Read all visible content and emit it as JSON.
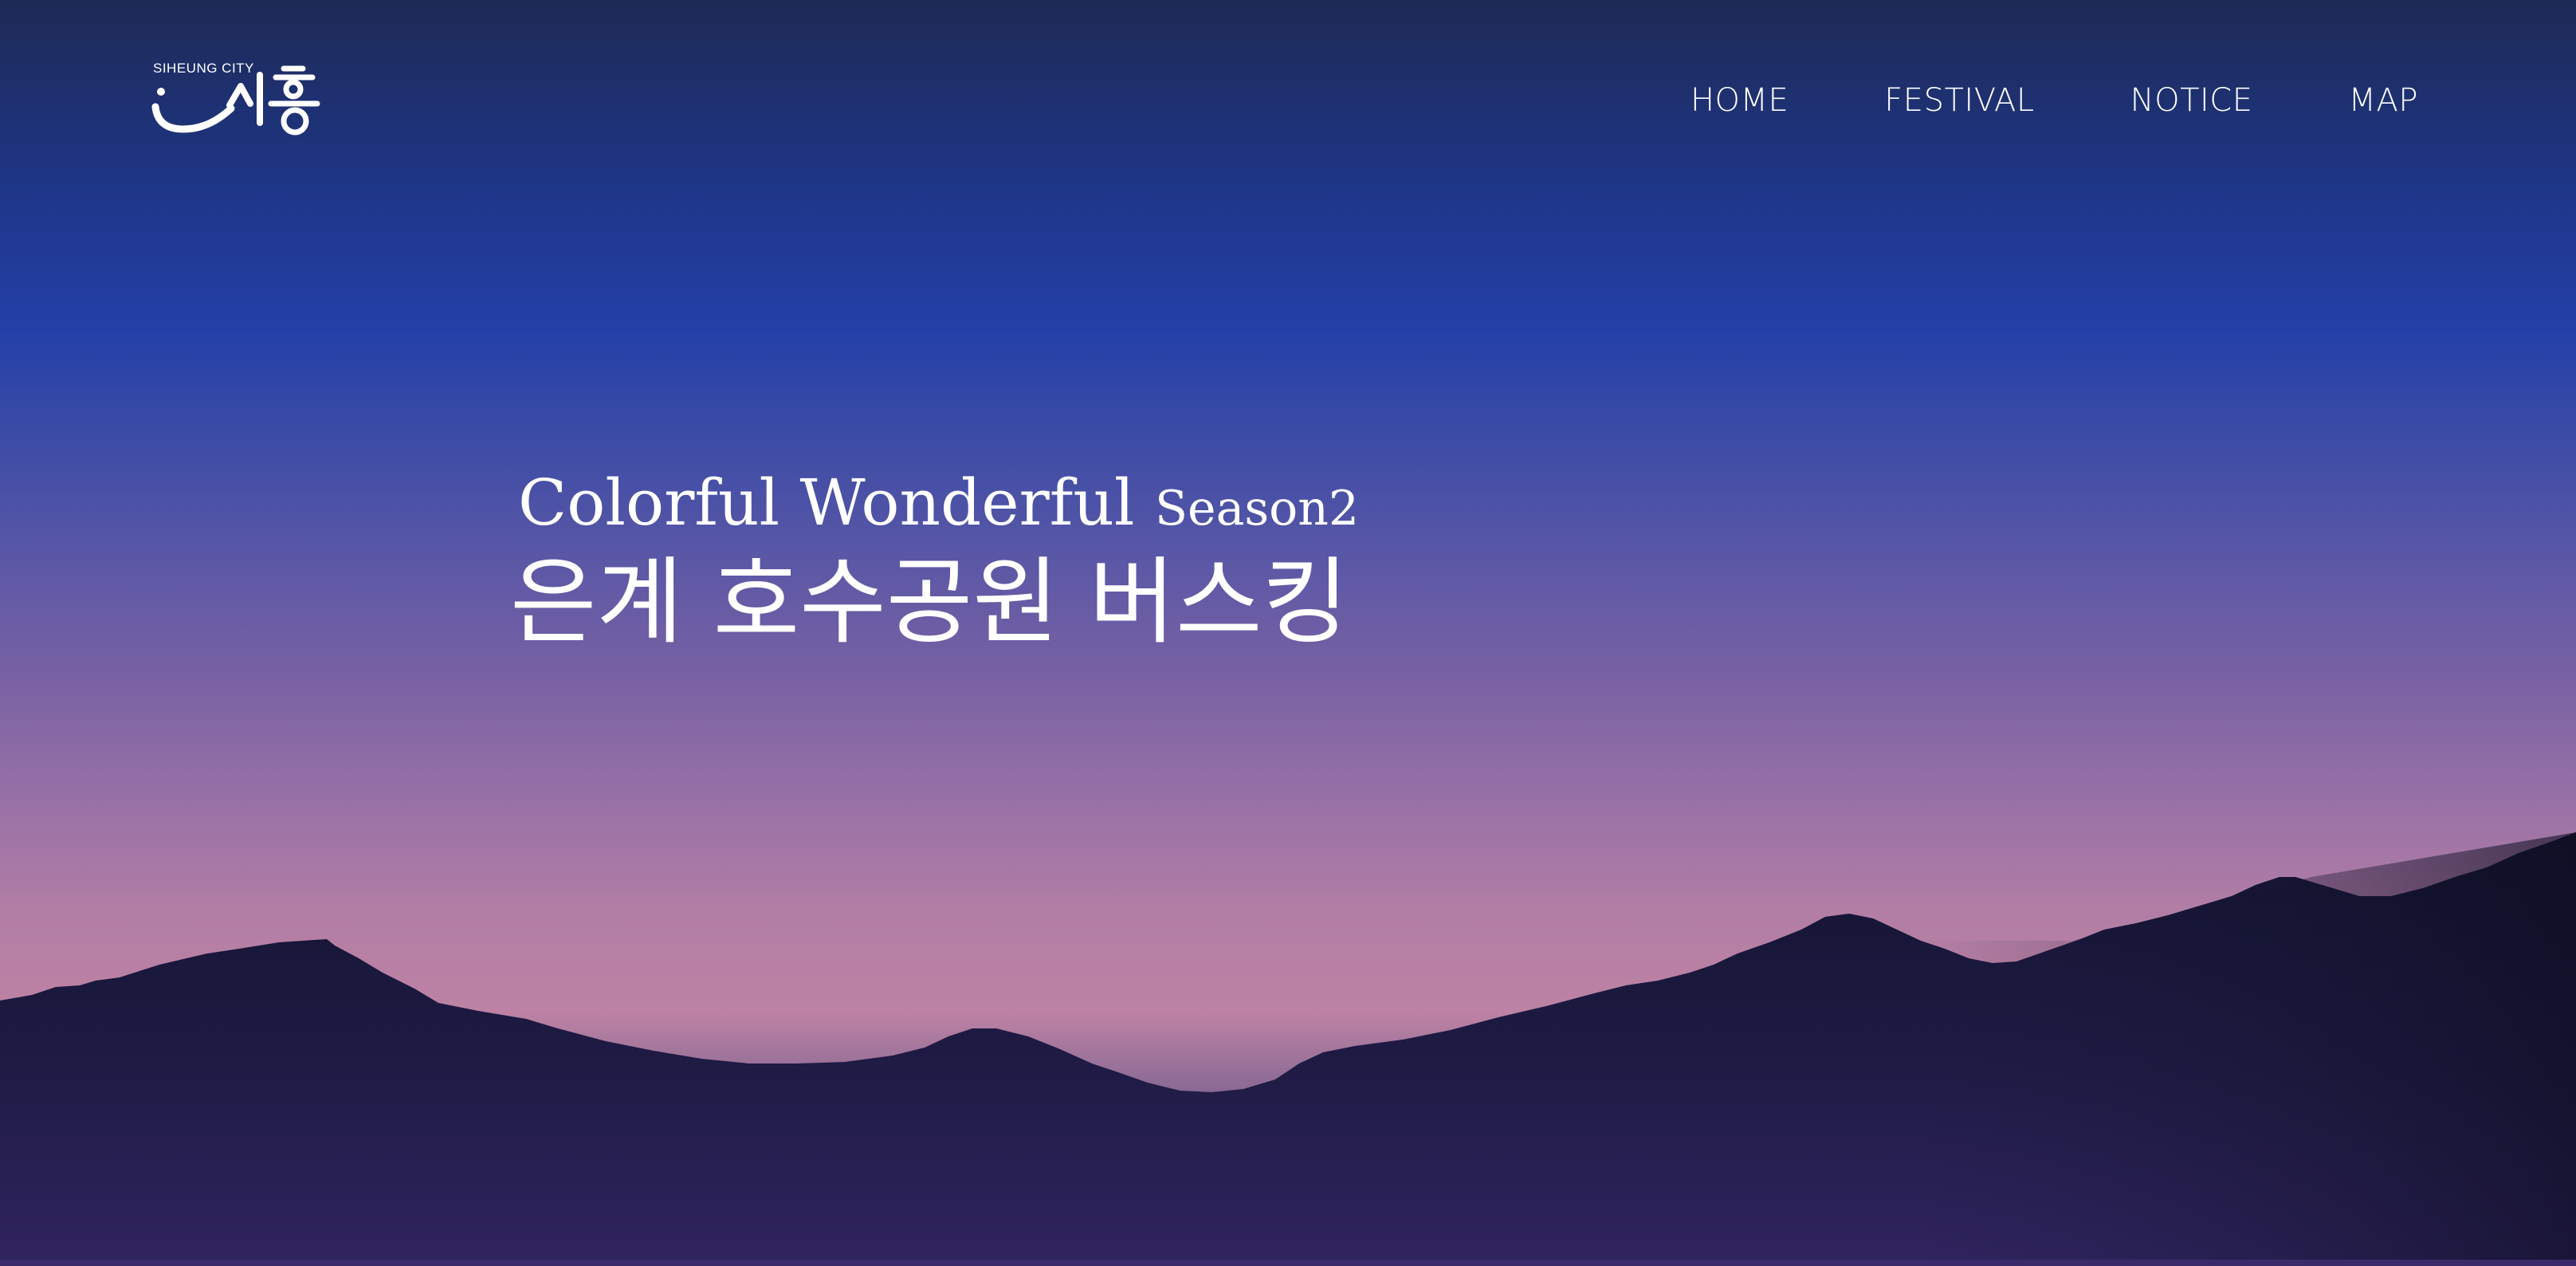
{
  "brand": {
    "caption": "SIHEUNG CITY",
    "wordmark": "시흥"
  },
  "nav": {
    "items": [
      {
        "label": "HOME"
      },
      {
        "label": "FESTIVAL"
      },
      {
        "label": "NOTICE"
      },
      {
        "label": "MAP"
      }
    ]
  },
  "hero": {
    "title_main": "Colorful Wonderful",
    "title_season": "Season2",
    "subtitle": "은계 호수공원 버스킹"
  },
  "colors": {
    "text": "#ffffff",
    "sky_top": "#1e2a55",
    "sky_blue": "#2440a8",
    "sky_pink": "#bd82a4",
    "mountain_dark": "#141430",
    "ground_bottom": "#2e2260"
  },
  "icons": {
    "logo": "siheung-city-logo"
  }
}
